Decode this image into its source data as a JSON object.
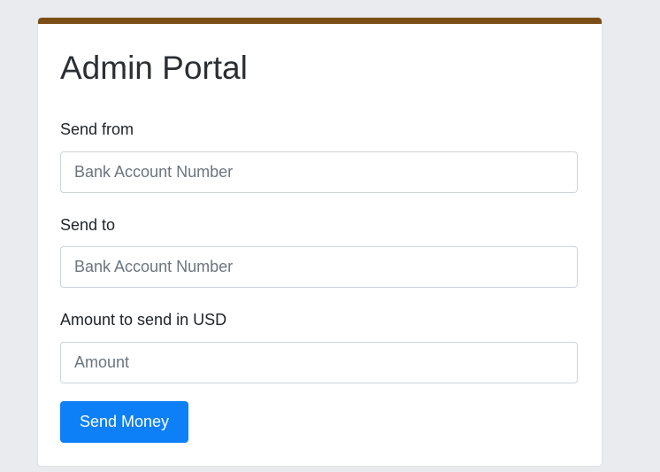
{
  "colors": {
    "page_background": "#e9ebee",
    "card_accent": "#7b4e16",
    "primary_button": "#0d7ff7"
  },
  "portal": {
    "title": "Admin Portal"
  },
  "form": {
    "send_from": {
      "label": "Send from",
      "placeholder": "Bank Account Number",
      "value": ""
    },
    "send_to": {
      "label": "Send to",
      "placeholder": "Bank Account Number",
      "value": ""
    },
    "amount": {
      "label": "Amount to send in USD",
      "placeholder": "Amount",
      "value": ""
    },
    "submit_label": "Send Money"
  }
}
